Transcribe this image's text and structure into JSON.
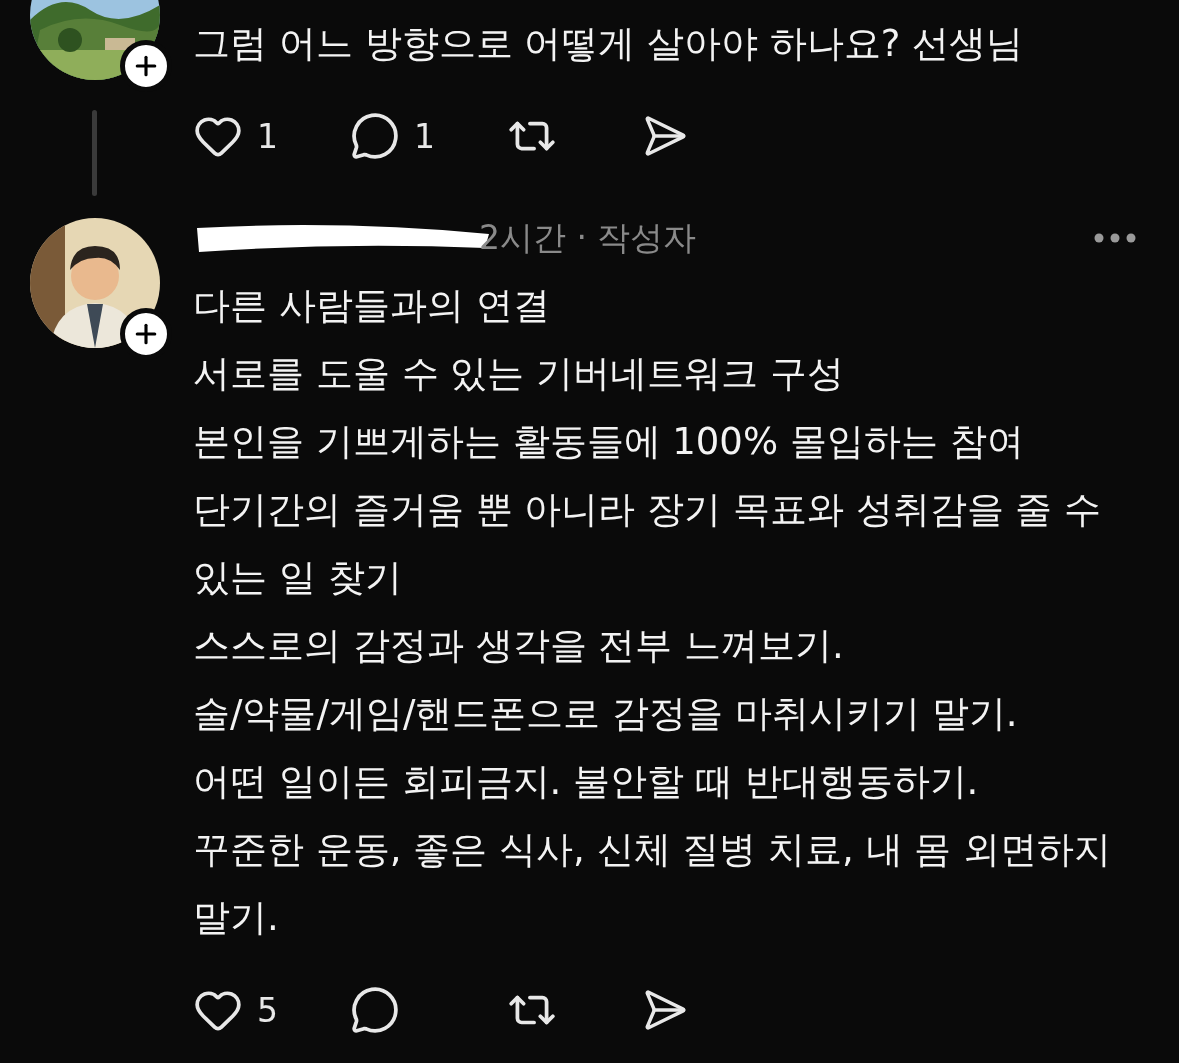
{
  "posts": [
    {
      "avatar": {
        "kind": "picture"
      },
      "body": [
        "그럼 어느 방향으로 어떻게 살아야 하나요? 선생님"
      ],
      "likes": "1",
      "comments": "1",
      "thread_line": true
    },
    {
      "avatar": {
        "kind": "figure"
      },
      "name_redacted": true,
      "meta": "2시간 · 작성자",
      "more_menu": true,
      "body": [
        "다른 사람들과의 연결",
        "서로를 도울 수 있는 기버네트워크 구성",
        "본인을 기쁘게하는 활동들에 100% 몰입하는 참여",
        "단기간의 즐거움 뿐 아니라 장기 목표와 성취감을 줄 수 있는 일 찾기",
        "스스로의 감정과 생각을 전부 느껴보기.",
        "술/약물/게임/핸드폰으로 감정을 마취시키기 말기.",
        "어떤 일이든 회피금지. 불안할 때 반대행동하기.",
        "꾸준한 운동, 좋은 식사, 신체 질병 치료, 내 몸 외면하지 말기."
      ],
      "likes": "5",
      "thread_line": false
    }
  ]
}
